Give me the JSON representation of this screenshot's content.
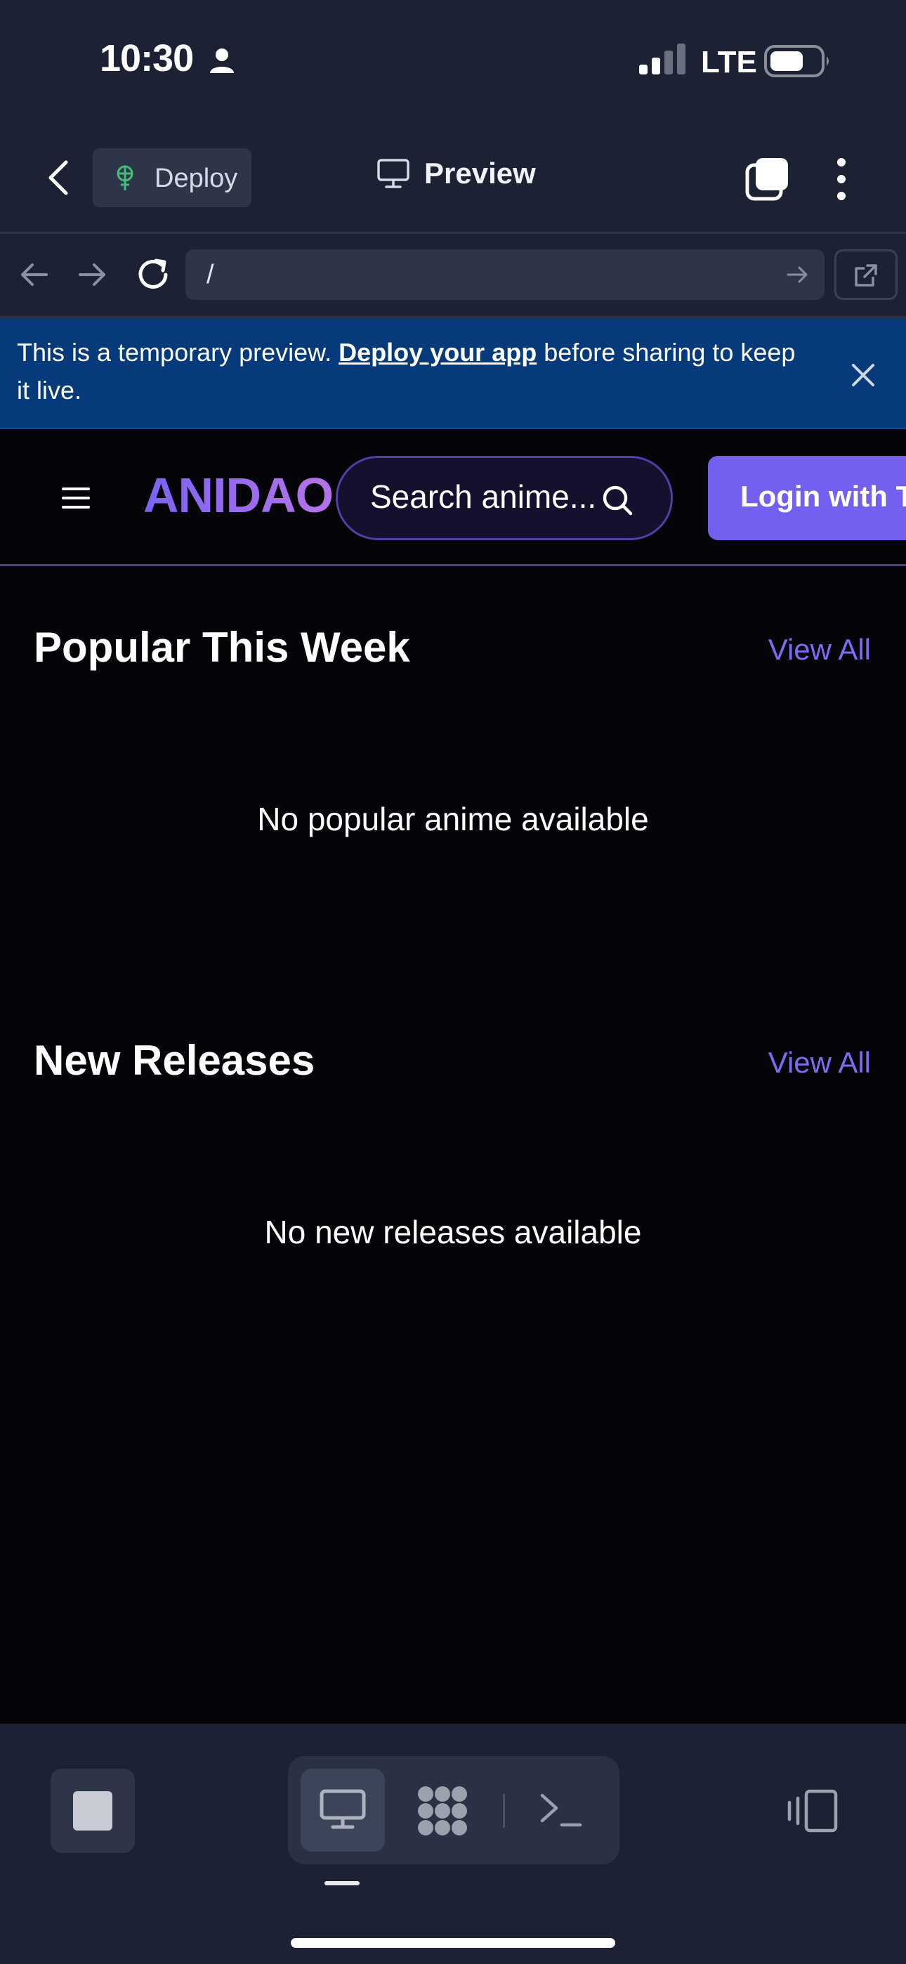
{
  "status_bar": {
    "time": "10:30",
    "network": "LTE"
  },
  "app_header": {
    "deploy_label": "Deploy",
    "title": "Preview"
  },
  "url_bar": {
    "value": "/"
  },
  "banner": {
    "text_before": "This is a temporary preview. ",
    "link_text": "Deploy your app",
    "text_after": " before sharing to keep it live."
  },
  "site": {
    "logo": "ANIDAO",
    "search_placeholder": "Search anime...",
    "login_label": "Login with T",
    "sections": [
      {
        "title": "Popular This Week",
        "view_all": "View All",
        "empty_message": "No popular anime available"
      },
      {
        "title": "New Releases",
        "view_all": "View All",
        "empty_message": "No new releases available"
      }
    ]
  },
  "colors": {
    "app_background": "#1c2133",
    "site_background": "#050409",
    "banner_background": "#063a7a",
    "accent": "#7360f0",
    "link_accent": "#7d6cf0"
  },
  "icons": [
    "person-icon",
    "signal-icon",
    "battery-icon",
    "back-icon",
    "deploy-icon",
    "monitor-icon",
    "tabs-icon",
    "more-icon",
    "nav-back-icon",
    "nav-forward-icon",
    "reload-icon",
    "url-go-icon",
    "external-icon",
    "close-icon",
    "hamburger-icon",
    "search-icon",
    "stop-icon",
    "mode-preview-icon",
    "mode-agent-icon",
    "mode-shell-icon",
    "device-icon"
  ]
}
